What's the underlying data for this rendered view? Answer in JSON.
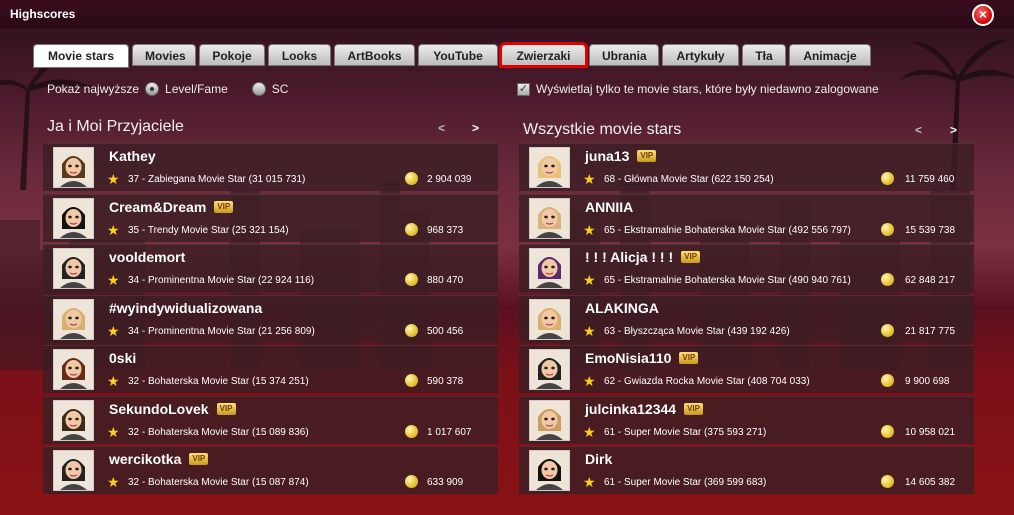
{
  "window": {
    "title": "Highscores",
    "close_glyph": "×"
  },
  "tabs": [
    {
      "label": "Movie stars"
    },
    {
      "label": "Movies"
    },
    {
      "label": "Pokoje"
    },
    {
      "label": "Looks"
    },
    {
      "label": "ArtBooks"
    },
    {
      "label": "YouTube"
    },
    {
      "label": "Zwierzaki"
    },
    {
      "label": "Ubrania"
    },
    {
      "label": "Artykuły"
    },
    {
      "label": "Tła"
    },
    {
      "label": "Animacje"
    }
  ],
  "show_highest": {
    "label": "Pokaż najwyższe",
    "option_level": "Level/Fame",
    "option_sc": "SC"
  },
  "recent_filter": {
    "label": "Wyświetlaj tylko te movie stars, które były niedawno zalogowane",
    "check": "✓"
  },
  "left_panel": {
    "title": "Ja i Moi Przyjaciele",
    "prev": "<",
    "next": ">",
    "rows": [
      {
        "name": "Kathey",
        "vip": "",
        "rank": "37 - Zabiegana Movie Star (31 015 731)",
        "sc": "2 904 039"
      },
      {
        "name": "Cream&Dream",
        "vip": "VIP",
        "rank": "35 - Trendy Movie Star (25 321 154)",
        "sc": "968 373"
      },
      {
        "name": "vooldemort",
        "vip": "",
        "rank": "34 - Prominentna Movie Star (22 924 116)",
        "sc": "880 470"
      },
      {
        "name": "#wyindywidualizowana",
        "vip": "",
        "rank": "34 - Prominentna Movie Star (21 256 809)",
        "sc": "500 456"
      },
      {
        "name": "0ski",
        "vip": "",
        "rank": "32 - Bohaterska Movie Star (15 374 251)",
        "sc": "590 378"
      },
      {
        "name": "SekundoLovek",
        "vip": "VIP",
        "rank": "32 - Bohaterska Movie Star (15 089 836)",
        "sc": "1 017 607"
      },
      {
        "name": "wercikotka",
        "vip": "VIP",
        "rank": "32 - Bohaterska Movie Star (15 087 874)",
        "sc": "633 909"
      }
    ]
  },
  "right_panel": {
    "title": "Wszystkie movie stars",
    "prev": "<",
    "next": ">",
    "rows": [
      {
        "name": "juna13",
        "vip": "VIP",
        "rank": "68 - Główna Movie Star (622 150 254)",
        "sc": "11 759 460"
      },
      {
        "name": "ANNIIA",
        "vip": "",
        "rank": "65 - Ekstramalnie Bohaterska Movie Star (492 556 797)",
        "sc": "15 539 738"
      },
      {
        "name": "! ! ! Alicja ! ! !",
        "vip": "VIP",
        "rank": "65 - Ekstramalnie Bohaterska Movie Star (490 940 761)",
        "sc": "62 848 217"
      },
      {
        "name": "ALAKINGA",
        "vip": "",
        "rank": "63 - Błyszcząca Movie Star (439 192 426)",
        "sc": "21 817 775"
      },
      {
        "name": "EmoNisia110",
        "vip": "VIP",
        "rank": "62 - Gwiazda Rocka Movie Star (408 704 033)",
        "sc": "9 900 698"
      },
      {
        "name": "julcinka12344",
        "vip": "VIP",
        "rank": "61 - Super Movie Star (375 593 271)",
        "sc": "10 958 021"
      },
      {
        "name": "Dirk",
        "vip": "",
        "rank": "61 - Super Movie Star (369 599 683)",
        "sc": "14 605 382"
      }
    ]
  },
  "colors": {
    "accent_highlight": "#e00000",
    "star": "#ffcf1f",
    "coin": "#e0b820",
    "vip_badge": "#f0c040"
  },
  "icons": {
    "star": "★",
    "coin": "sc-coin-icon",
    "vip": "vip-badge-icon",
    "close": "close-icon"
  }
}
